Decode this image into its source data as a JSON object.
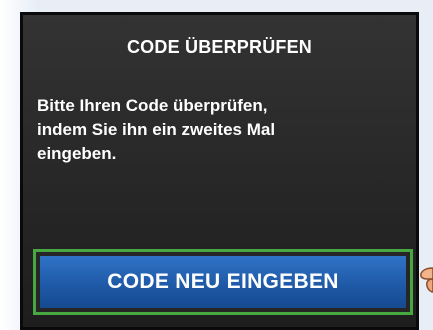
{
  "screen": {
    "title": "CODE ÜBERPRÜFEN",
    "message_line1": "Bitte Ihren Code überprüfen,",
    "message_line2": "indem Sie ihn ein zweites Mal",
    "message_line3": "eingeben.",
    "button_label": "CODE NEU EINGEBEN"
  },
  "colors": {
    "screen_bg": "#2b2b2b",
    "button_blue": "#1f5aa8",
    "highlight_green": "#47a83f",
    "text": "#ffffff"
  },
  "icons": {
    "pointer": "pointing-hand-icon"
  }
}
